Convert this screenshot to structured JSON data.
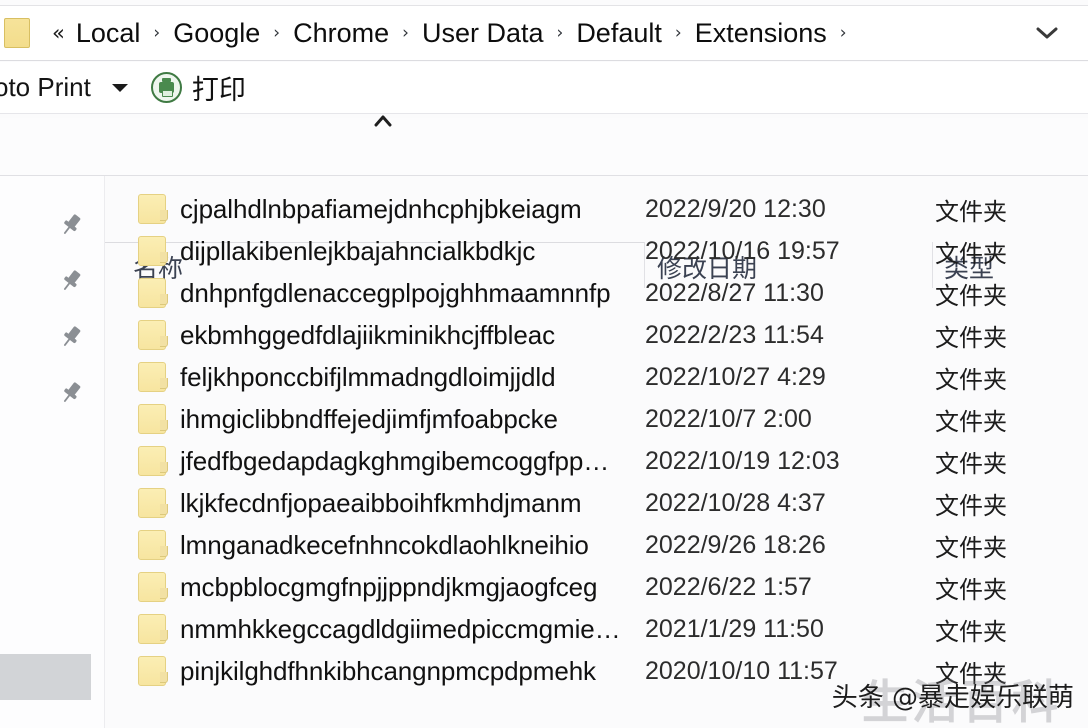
{
  "addressbar": {
    "folder_icon": "folder-icon",
    "overflow_label": "«",
    "separator": "›",
    "crumbs": [
      "Local",
      "Google",
      "Chrome",
      "User Data",
      "Default",
      "Extensions"
    ],
    "dropdown_icon": "chevron-down-icon"
  },
  "toolbar": {
    "photo_print_label": "oto Print",
    "caret_icon": "caret-down-icon",
    "printer_icon": "printer-icon",
    "print_label": "打印"
  },
  "columns": {
    "sort_indicator": "˄",
    "name": "名称",
    "date_modified": "修改日期",
    "type": "类型"
  },
  "leftpane": {
    "pin_icon": "pin-icon",
    "pin_count": 4
  },
  "files": [
    {
      "name": "cjpalhdlnbpafiamejdnhcphjbkeiagm",
      "date": "2022/9/20 12:30",
      "type": "文件夹"
    },
    {
      "name": "dijpllakibenlejkbajahncialkbdkjc",
      "date": "2022/10/16 19:57",
      "type": "文件夹"
    },
    {
      "name": "dnhpnfgdlenaccegplpojghhmaamnnfp",
      "date": "2022/8/27 11:30",
      "type": "文件夹"
    },
    {
      "name": "ekbmhggedfdlajiikminikhcjffbleac",
      "date": "2022/2/23 11:54",
      "type": "文件夹"
    },
    {
      "name": "feljkhponccbifjlmmadngdloimjjdld",
      "date": "2022/10/27 4:29",
      "type": "文件夹"
    },
    {
      "name": "ihmgiclibbndffejedjimfjmfoabpcke",
      "date": "2022/10/7 2:00",
      "type": "文件夹"
    },
    {
      "name": "jfedfbgedapdagkghmgibemcoggfpp…",
      "date": "2022/10/19 12:03",
      "type": "文件夹"
    },
    {
      "name": "lkjkfecdnfjopaeaibboihfkmhdjmanm",
      "date": "2022/10/28 4:37",
      "type": "文件夹"
    },
    {
      "name": "lmnganadkecefnhncokdlaohlkneihio",
      "date": "2022/9/26 18:26",
      "type": "文件夹"
    },
    {
      "name": "mcbpblocgmgfnpjjppndjkmgjaogfceg",
      "date": "2022/6/22 1:57",
      "type": "文件夹"
    },
    {
      "name": "nmmhkkegccagdldgiimedpiccmgmie…",
      "date": "2021/1/29 11:50",
      "type": "文件夹"
    },
    {
      "name": "pinjkilghdfhnkibhcangnpmcpdpmehk",
      "date": "2020/10/10 11:57",
      "type": "文件夹"
    }
  ],
  "watermark": {
    "main": "头条 @暴走娱乐联萌",
    "ghost": "生活百科"
  },
  "colors": {
    "folder_yellow": "#f7e5a0",
    "printer_green": "#4a8a4e",
    "header_text": "#3b4252",
    "background": "#fbfbfc"
  }
}
